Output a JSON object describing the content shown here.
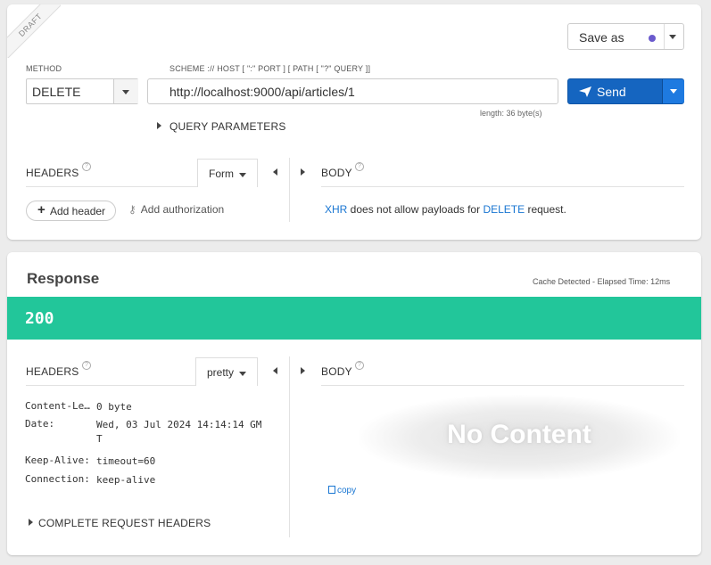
{
  "request": {
    "draft_label": "DRAFT",
    "save_as_label": "Save as",
    "method_label": "METHOD",
    "method_value": "DELETE",
    "url_label": "SCHEME :// HOST [ \":\" PORT ] [ PATH [ \"?\" QUERY ]]",
    "url_value": "http://localhost:9000/api/articles/1",
    "url_length": "length: 36 byte(s)",
    "send_label": "Send",
    "query_params_label": "QUERY PARAMETERS",
    "headers_label": "HEADERS",
    "headers_mode": "Form",
    "body_label": "BODY",
    "add_header_label": "Add header",
    "add_auth_label": "Add authorization",
    "body_note": {
      "xhr": "XHR",
      "text1": " does not allow payloads for ",
      "method": "DELETE",
      "text2": " request."
    }
  },
  "response": {
    "title": "Response",
    "cache_info": "Cache Detected - Elapsed Time: 12ms",
    "status_code": "200",
    "headers_label": "HEADERS",
    "headers_mode": "pretty",
    "body_label": "BODY",
    "headers": [
      {
        "key": "Content-Le…",
        "value": "0 byte"
      },
      {
        "key": "Date:",
        "value": "Wed, 03 Jul 2024 14:14:14 GMT"
      },
      {
        "key": "Keep-Alive:",
        "value": "timeout=60"
      },
      {
        "key": "Connection:",
        "value": "keep-alive"
      }
    ],
    "complete_headers_label": "COMPLETE REQUEST HEADERS",
    "no_content": "No Content",
    "copy_label": "copy"
  },
  "colors": {
    "send": "#1565c0",
    "status_ok": "#22c69a",
    "link": "#1976d2",
    "save_dot": "#6a5acd"
  }
}
